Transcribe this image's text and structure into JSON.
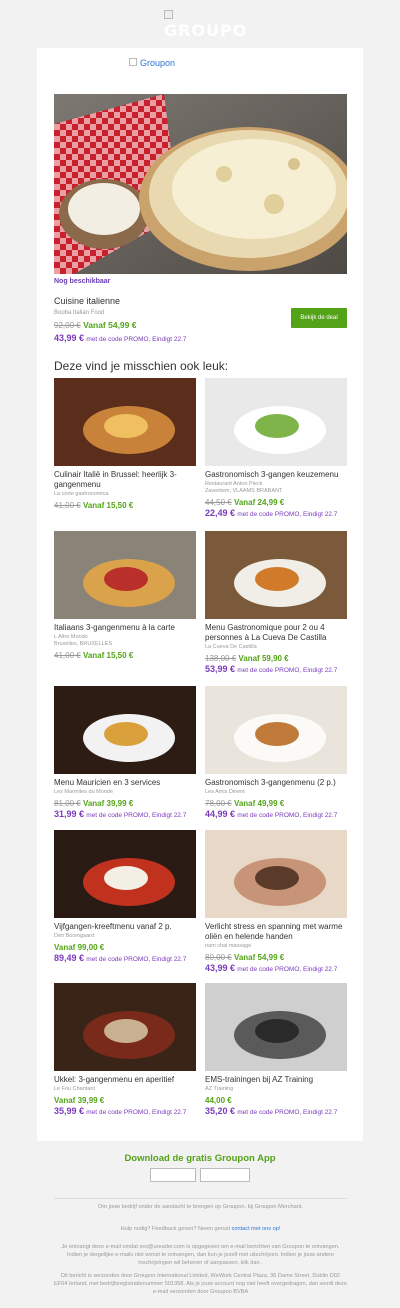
{
  "header": {
    "logo_text": "GROUPO",
    "card_logo_alt": "Groupon"
  },
  "featured": {
    "label": "Nog beschikbaar",
    "title": "Cuisine italienne",
    "merchant": "Booba Italian Food",
    "old_price": "92,00 €",
    "price": "Vanaf 54,99 €",
    "promo_price": "43,99 €",
    "promo_text": "met de code PROMO, Eindigt 22.7",
    "button": "Bekijk de deal"
  },
  "section_heading": "Deze vind je misschien ook leuk:",
  "tiles": [
    {
      "title": "Culinair Italië in Brussel: heerlijk 3-gangenmenu",
      "merchant": "La corte gastronomica",
      "old": "41,00 €",
      "price": "Vanaf 15,50 €",
      "promo": "",
      "promo_text": ""
    },
    {
      "title": "Gastronomisch 3-gangen keuzemenu",
      "merchant": "Restaurant Anton Pieck\nZaventem, VLAAMS BRABANT",
      "old": "44,50 €",
      "price": "Vanaf 24,99 €",
      "promo": "22,49 €",
      "promo_text": "met de code PROMO, Eindigt 22.7"
    },
    {
      "title": "Italiaans 3-gangenmenu à la carte",
      "merchant": "L Altro Mondo\nBruxelles, BRUXELLES",
      "old": "41,00 €",
      "price": "Vanaf 15,50 €",
      "promo": "",
      "promo_text": ""
    },
    {
      "title": "Menu Gastronomique pour 2 ou 4 personnes à La Cueva De Castilla",
      "merchant": "La Cueva De Castilla",
      "old": "138,00 €",
      "price": "Vanaf 59,90 €",
      "promo": "53,99 €",
      "promo_text": "met de code PROMO, Eindigt 22.7"
    },
    {
      "title": "Menu Mauricien en 3 services",
      "merchant": "Les Marmites du Monde",
      "old": "81,00 €",
      "price": "Vanaf 39,99 €",
      "promo": "31,99 €",
      "promo_text": "met de code PROMO, Eindigt 22.7"
    },
    {
      "title": "Gastronomisch 3-gangenmenu (2 p.)",
      "merchant": "Les Amis Dinent",
      "old": "78,00 €",
      "price": "Vanaf 49,99 €",
      "promo": "44,99 €",
      "promo_text": "met de code PROMO, Eindigt 22.7"
    },
    {
      "title": "Vijfgangen-kreeftmenu vanaf 2 p.",
      "merchant": "Den Boomgaard",
      "old": "",
      "price": "Vanaf 99,00 €",
      "promo": "89,49 €",
      "promo_text": "met de code PROMO, Eindigt 22.7"
    },
    {
      "title": "Verlicht stress en spanning met warme oliën en helende handen",
      "merchant": "nam chai massage",
      "old": "80,00 €",
      "price": "Vanaf 54,99 €",
      "promo": "43,99 €",
      "promo_text": "met de code PROMO, Eindigt 22.7"
    },
    {
      "title": "Ukkel: 3-gangenmenu en aperitief",
      "merchant": "Le Fou Chantant",
      "old": "",
      "price": "Vanaf 39,99 €",
      "promo": "35,99 €",
      "promo_text": "met de code PROMO, Eindigt 22.7"
    },
    {
      "title": "EMS-trainingen bij AZ Training",
      "merchant": "AZ Training",
      "old": "",
      "price": "44,00 €",
      "promo": "35,20 €",
      "promo_text": "met de code PROMO, Eindigt 22.7"
    }
  ],
  "app": {
    "title": "Download de gratis Groupon App"
  },
  "footer": {
    "merchant_line": "Om jouw bedrijf onder de aandacht te brengen op Groupon, bij Groupon Merchant.",
    "help_prefix": "Hulp nodig? Feedback geven? Neem gerust",
    "help_link": "contact met ons op!",
    "subscription": "Je ontvangt deze e-mail omdat xxx@ureader.com is opgegeven om e-mail berichten van Groupon te ontvangen. Indien je dergelijke e-mails niet wenst te ontvangen, dan kun je jezelf met uitschrijven. Indien je jouw andere inschrijvingen wil beheren of aanpassen, klik dan .",
    "company": "Dit bericht is verzonden door Groupon International Limited, WeWork Central Plaza, 36 Dame Street, Dublin D02 EF64 Ierland, met bedrijfsregistratienummer 501358. Als je jouw account nog niet heeft overgedragen, dan wordt deze e-mail verzonden door Groupon BVBA"
  },
  "colors": {
    "green": "#53a318",
    "purple": "#7a3bbd",
    "link": "#2a75d6"
  }
}
